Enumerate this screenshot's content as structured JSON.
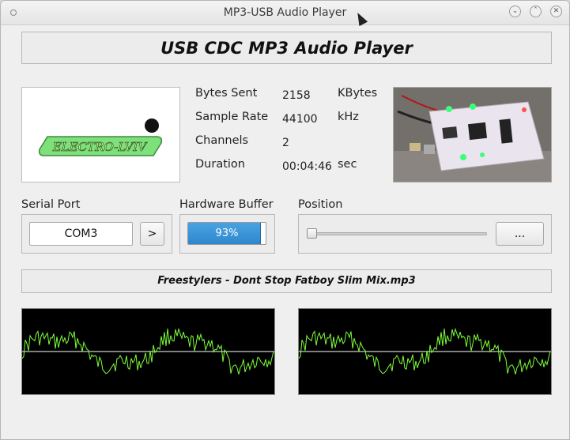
{
  "window": {
    "title": "MP3-USB Audio Player",
    "controls": [
      "chevron-down-icon",
      "chevron-up-icon",
      "close-icon"
    ]
  },
  "header": {
    "title": "USB CDC MP3 Audio Player"
  },
  "logo": {
    "text": "ELECTRO-LVIV"
  },
  "info": {
    "rows": [
      {
        "label": "Bytes Sent",
        "value": "2158",
        "unit": "KBytes"
      },
      {
        "label": "Sample Rate",
        "value": "44100",
        "unit": "kHz"
      },
      {
        "label": "Channels",
        "value": "2",
        "unit": ""
      },
      {
        "label": "Duration",
        "value": "00:04:46",
        "unit": "sec"
      }
    ]
  },
  "serial": {
    "label": "Serial Port",
    "port": "COM3",
    "connect_label": ">"
  },
  "buffer": {
    "label": "Hardware Buffer",
    "percent": 93,
    "text": "93%"
  },
  "position": {
    "label": "Position",
    "value": 0,
    "browse_label": "..."
  },
  "track": {
    "name": "Freestylers - Dont Stop Fatboy Slim Mix.mp3"
  },
  "colors": {
    "accent": "#2f86cf",
    "scope_trace": "#7dff3a",
    "scope_bg": "#000000",
    "logo_green": "#7de07a"
  }
}
